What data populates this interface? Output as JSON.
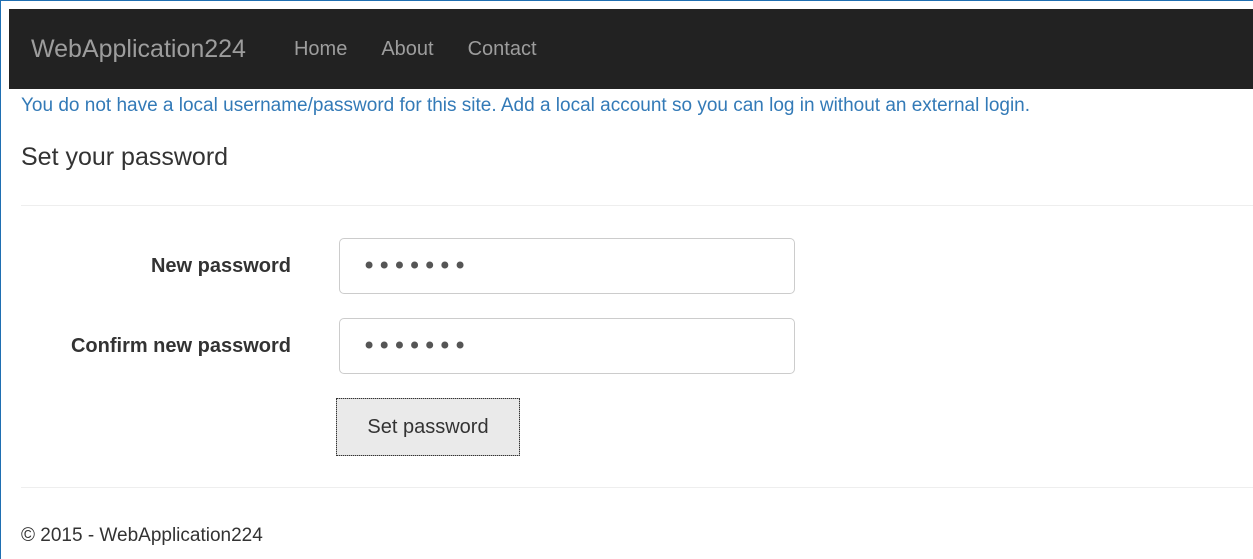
{
  "navbar": {
    "brand": "WebApplication224",
    "links": [
      "Home",
      "About",
      "Contact"
    ]
  },
  "message": "You do not have a local username/password for this site. Add a local account so you can log in without an external login.",
  "form": {
    "heading": "Set your password",
    "new_password": {
      "label": "New password",
      "value": "•••••••"
    },
    "confirm_password": {
      "label": "Confirm new password",
      "value": "•••••••"
    },
    "submit_label": "Set password"
  },
  "footer": {
    "text": "© 2015 - WebApplication224"
  },
  "colors": {
    "navbar_bg": "#222222",
    "nav_text": "#9d9d9d",
    "link_blue": "#337ab7"
  }
}
